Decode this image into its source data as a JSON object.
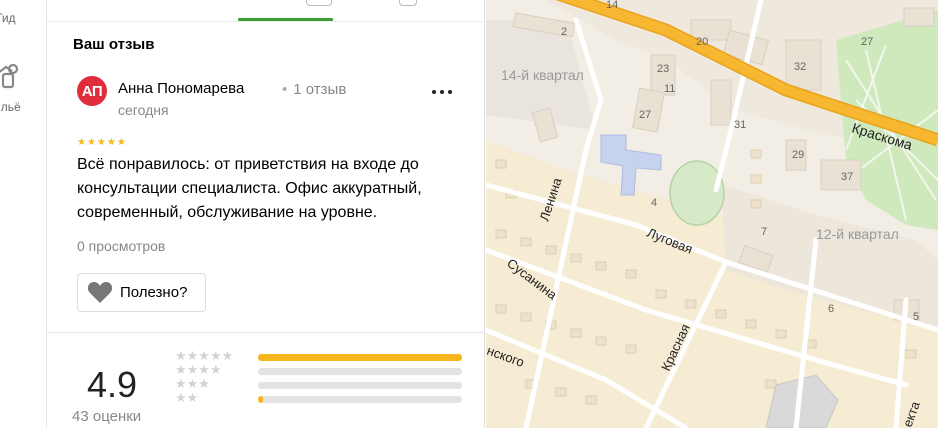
{
  "rail": {
    "items": [
      {
        "label": "Гид",
        "icon": "guide-icon"
      },
      {
        "label": "ильё",
        "icon": "housing-icon"
      }
    ]
  },
  "review": {
    "section_title": "Ваш отзыв",
    "author": {
      "initials": "АП",
      "name": "Анна Пономарева",
      "reviews": "1 отзыв",
      "avatar_color": "#e02d3c"
    },
    "date": "сегодня",
    "rating": 5,
    "text": "Всё понравилось: от приветствия на входе до консультации специалиста. Офис аккуратный, современный, обслуживание на уровне.",
    "views": "0 просмотров",
    "useful_label": "Полезно?"
  },
  "summary": {
    "rating": "4.9",
    "count": "43 оценки",
    "rows": [
      {
        "stars": 5,
        "fraction": 1.0
      },
      {
        "stars": 4,
        "fraction": 0
      },
      {
        "stars": 3,
        "fraction": 0
      },
      {
        "stars": 2,
        "fraction": 0.025
      }
    ]
  },
  "map": {
    "streets": [
      "Краскома",
      "Ленина",
      "Луговая",
      "Сусанина",
      "Красная",
      "нского",
      "екта"
    ],
    "districts": [
      "14-й квартал",
      "12-й квартал"
    ],
    "houses": [
      "14",
      "2",
      "20",
      "32",
      "27",
      "23",
      "11",
      "27",
      "31",
      "29",
      "37",
      "4",
      "7",
      "6",
      "5"
    ],
    "colors": {
      "road": "#f7b731",
      "green": "#cfe8bc",
      "building": "#e8e1d4",
      "school": "#c7d2ef"
    }
  },
  "colors": {
    "accent_green": "#3a9e35",
    "star": "#f6b61e"
  }
}
